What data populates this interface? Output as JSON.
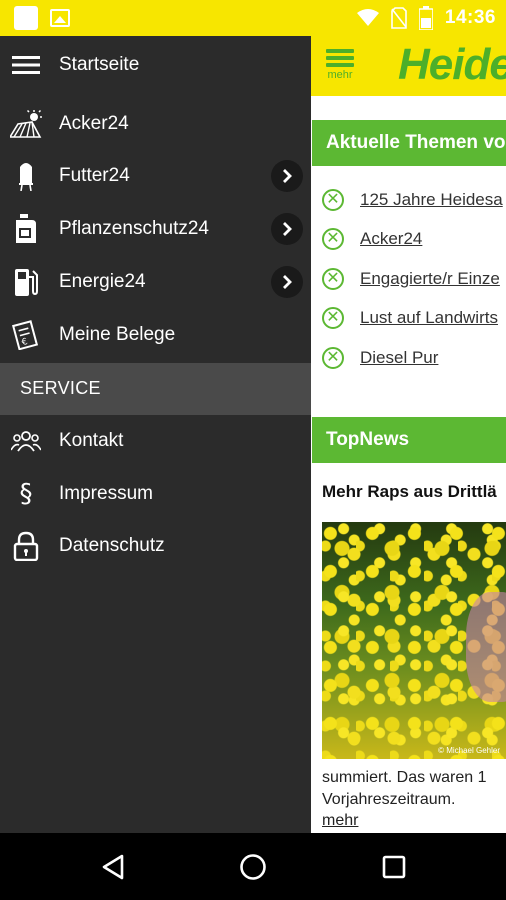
{
  "status_bar": {
    "time": "14:36"
  },
  "app": {
    "menu_label": "mehr",
    "brand": "Heide",
    "topics_heading": "Aktuelle Themen vo",
    "topics": [
      {
        "label": "125 Jahre Heidesa"
      },
      {
        "label": "Acker24"
      },
      {
        "label": "Engagierte/r Einze"
      },
      {
        "label": "Lust auf Landwirts"
      },
      {
        "label": "Diesel Pur"
      }
    ],
    "topnews_heading": "TopNews",
    "news": {
      "title": "Mehr Raps aus Drittlä",
      "image_credit": "© Michael Gehler",
      "text_line1": "summiert. Das waren 1",
      "text_line2": "Vorjahreszeitraum.",
      "more": "mehr"
    }
  },
  "drawer": {
    "items": [
      {
        "label": "Startseite",
        "icon": "hamburger-icon"
      },
      {
        "label": "Acker24",
        "icon": "field-sun-icon"
      },
      {
        "label": "Futter24",
        "icon": "silo-icon",
        "has_submenu": true
      },
      {
        "label": "Pflanzenschutz24",
        "icon": "canister-icon",
        "has_submenu": true
      },
      {
        "label": "Energie24",
        "icon": "fuel-pump-icon",
        "has_submenu": true
      },
      {
        "label": "Meine Belege",
        "icon": "receipts-icon"
      }
    ],
    "section_title": "SERVICE",
    "service_items": [
      {
        "label": "Kontakt",
        "icon": "people-icon"
      },
      {
        "label": "Impressum",
        "icon": "paragraph-icon"
      },
      {
        "label": "Datenschutz",
        "icon": "lock-icon"
      }
    ]
  },
  "colors": {
    "brand_yellow": "#f7e600",
    "brand_green": "#5cb833",
    "drawer_bg": "#2b2b2b",
    "service_bg": "#4a4a4a"
  }
}
